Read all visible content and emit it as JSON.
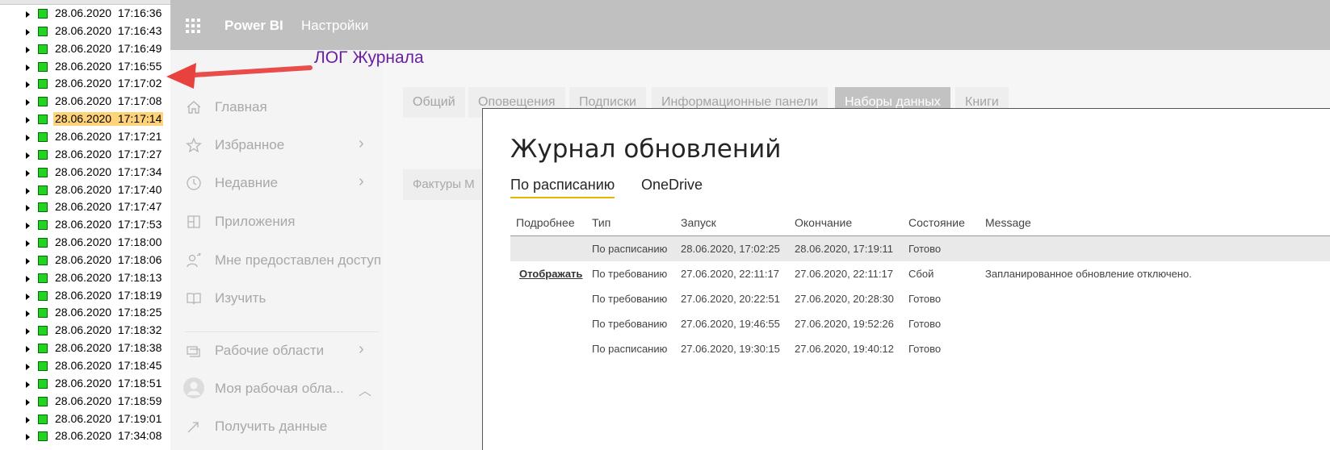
{
  "log": {
    "items": [
      {
        "date": "28.06.2020",
        "time": "17:16:36",
        "highlighted": false
      },
      {
        "date": "28.06.2020",
        "time": "17:16:43",
        "highlighted": false
      },
      {
        "date": "28.06.2020",
        "time": "17:16:49",
        "highlighted": false
      },
      {
        "date": "28.06.2020",
        "time": "17:16:55",
        "highlighted": false
      },
      {
        "date": "28.06.2020",
        "time": "17:17:02",
        "highlighted": false
      },
      {
        "date": "28.06.2020",
        "time": "17:17:08",
        "highlighted": false
      },
      {
        "date": "28.06.2020",
        "time": "17:17:14",
        "highlighted": true
      },
      {
        "date": "28.06.2020",
        "time": "17:17:21",
        "highlighted": false
      },
      {
        "date": "28.06.2020",
        "time": "17:17:27",
        "highlighted": false
      },
      {
        "date": "28.06.2020",
        "time": "17:17:34",
        "highlighted": false
      },
      {
        "date": "28.06.2020",
        "time": "17:17:40",
        "highlighted": false
      },
      {
        "date": "28.06.2020",
        "time": "17:17:47",
        "highlighted": false
      },
      {
        "date": "28.06.2020",
        "time": "17:17:53",
        "highlighted": false
      },
      {
        "date": "28.06.2020",
        "time": "17:18:00",
        "highlighted": false
      },
      {
        "date": "28.06.2020",
        "time": "17:18:06",
        "highlighted": false
      },
      {
        "date": "28.06.2020",
        "time": "17:18:13",
        "highlighted": false
      },
      {
        "date": "28.06.2020",
        "time": "17:18:19",
        "highlighted": false
      },
      {
        "date": "28.06.2020",
        "time": "17:18:25",
        "highlighted": false
      },
      {
        "date": "28.06.2020",
        "time": "17:18:32",
        "highlighted": false
      },
      {
        "date": "28.06.2020",
        "time": "17:18:38",
        "highlighted": false
      },
      {
        "date": "28.06.2020",
        "time": "17:18:45",
        "highlighted": false
      },
      {
        "date": "28.06.2020",
        "time": "17:18:51",
        "highlighted": false
      },
      {
        "date": "28.06.2020",
        "time": "17:18:59",
        "highlighted": false
      },
      {
        "date": "28.06.2020",
        "time": "17:19:01",
        "highlighted": false
      },
      {
        "date": "28.06.2020",
        "time": "17:34:08",
        "highlighted": false
      }
    ]
  },
  "header": {
    "brand": "Power BI",
    "title": "Настройки"
  },
  "nav": {
    "items": [
      {
        "label": "Главная",
        "icon": "home-icon",
        "chevron": ""
      },
      {
        "label": "Избранное",
        "icon": "star-icon",
        "chevron": "›"
      },
      {
        "label": "Недавние",
        "icon": "clock-icon",
        "chevron": "›"
      },
      {
        "label": "Приложения",
        "icon": "apps-icon",
        "chevron": ""
      },
      {
        "label": "Мне предоставлен доступ",
        "icon": "shared-icon",
        "chevron": ""
      },
      {
        "label": "Изучить",
        "icon": "book-icon",
        "chevron": ""
      },
      {
        "label": "Рабочие области",
        "icon": "workspaces-icon",
        "chevron": "›"
      },
      {
        "label": "Моя рабочая обла...",
        "icon": "avatar-icon",
        "chevron": "︿"
      },
      {
        "label": "Получить данные",
        "icon": "get-data-icon",
        "chevron": ""
      }
    ]
  },
  "tabs": [
    {
      "label": "Общий",
      "active": false
    },
    {
      "label": "Оповещения",
      "active": false
    },
    {
      "label": "Подписки",
      "active": false
    },
    {
      "label": "Информационные панели",
      "active": false
    },
    {
      "label": "Наборы данных",
      "active": true
    },
    {
      "label": "Книги",
      "active": false
    }
  ],
  "dataset_item": "Фактуры М",
  "dialog": {
    "title": "Журнал обновлений",
    "tabs": [
      {
        "label": "По расписанию",
        "active": true
      },
      {
        "label": "OneDrive",
        "active": false
      }
    ],
    "columns": [
      "Подробнее",
      "Тип",
      "Запуск",
      "Окончание",
      "Состояние",
      "Message"
    ],
    "rows": [
      {
        "details": "",
        "type": "По расписанию",
        "start": "28.06.2020, 17:02:25",
        "end": "28.06.2020, 17:19:11",
        "status": "Готово",
        "message": ""
      },
      {
        "details": "Отображать",
        "type": "По требованию",
        "start": "27.06.2020, 22:11:17",
        "end": "27.06.2020, 22:11:17",
        "status": "Сбой",
        "message": "Запланированное обновление отключено."
      },
      {
        "details": "",
        "type": "По требованию",
        "start": "27.06.2020, 20:22:51",
        "end": "27.06.2020, 20:28:30",
        "status": "Готово",
        "message": ""
      },
      {
        "details": "",
        "type": "По требованию",
        "start": "27.06.2020, 19:46:55",
        "end": "27.06.2020, 19:52:26",
        "status": "Готово",
        "message": ""
      },
      {
        "details": "",
        "type": "По расписанию",
        "start": "27.06.2020, 19:30:15",
        "end": "27.06.2020, 19:40:12",
        "status": "Готово",
        "message": ""
      }
    ]
  },
  "annotation": {
    "text": "ЛОГ Журнала"
  },
  "colors": {
    "header_bg": "#c0c0c0",
    "active_tab_bg": "#c2c2c2",
    "dialog_tab_underline": "#e8b500",
    "log_status_green": "#22d322",
    "log_highlight": "#ffd37a",
    "annotation_text": "#6b1fa0",
    "annotation_arrow": "#e8423f"
  }
}
